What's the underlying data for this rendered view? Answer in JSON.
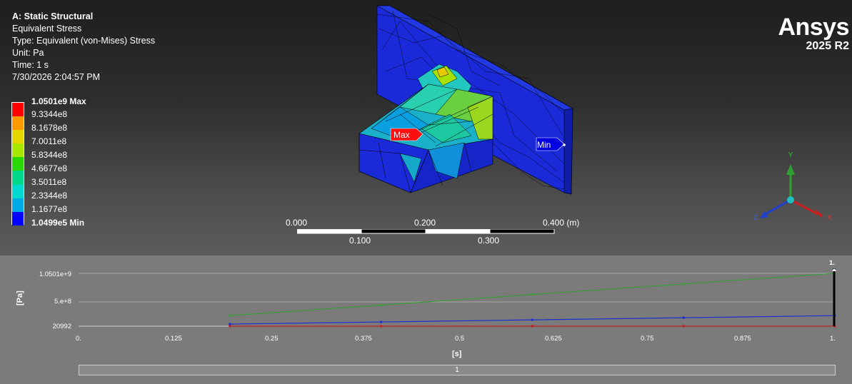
{
  "info": {
    "title": "A: Static Structural",
    "result": "Equivalent Stress",
    "type": "Type: Equivalent (von-Mises) Stress",
    "unit": "Unit: Pa",
    "time": "Time: 1 s",
    "date": "7/30/2026 2:04:57 PM"
  },
  "legend": {
    "max_label": "1.0501e9 Max",
    "min_label": "1.0499e5 Min",
    "levels": [
      "9.3344e8",
      "8.1678e8",
      "7.0011e8",
      "5.8344e8",
      "4.6677e8",
      "3.5011e8",
      "2.3344e8",
      "1.1677e8"
    ],
    "colors": [
      "#ff0000",
      "#ff9900",
      "#e5d600",
      "#a8e800",
      "#29d800",
      "#00d98a",
      "#00d9d0",
      "#00a8e5",
      "#0000ff"
    ]
  },
  "logo": {
    "name": "Ansys",
    "version": "2025 R2"
  },
  "probes": {
    "max": "Max",
    "min": "Min"
  },
  "scale_bar": {
    "top_labels": [
      "0.000",
      "0.200",
      "0.400 (m)"
    ],
    "bottom_labels": [
      "0.100",
      "0.300"
    ]
  },
  "triad": {
    "x": "X",
    "y": "Y",
    "z": "Z"
  },
  "chart": {
    "y_title": "[Pa]",
    "x_title": "[s]",
    "y_ticks": [
      "1.0501e+9",
      "5.e+8",
      "20992"
    ],
    "x_ticks": [
      "0.",
      "0.125",
      "0.25",
      "0.375",
      "0.5",
      "0.625",
      "0.75",
      "0.875",
      "1."
    ],
    "marker_label": "1.",
    "timeline_label": "1"
  },
  "chart_data": {
    "type": "line",
    "x": [
      0.2,
      0.4,
      0.6,
      0.8,
      1.0
    ],
    "series": [
      {
        "values": [
          210000000.0,
          420000000.0,
          630000000.0,
          840000000.0,
          1050100000.0
        ],
        "color": "#3a9d3a"
      },
      {
        "values": [
          42000000.0,
          84000000.0,
          126000000.0,
          168000000.0,
          210000000.0
        ],
        "color": "#1a2fd0"
      },
      {
        "values": [
          20992,
          41984,
          62976,
          83968,
          104990
        ],
        "color": "#c02020"
      }
    ],
    "xlim": [
      0,
      1
    ],
    "ylim": [
      20992,
      1050100000.0
    ],
    "xlabel": "[s]",
    "ylabel": "[Pa]"
  }
}
